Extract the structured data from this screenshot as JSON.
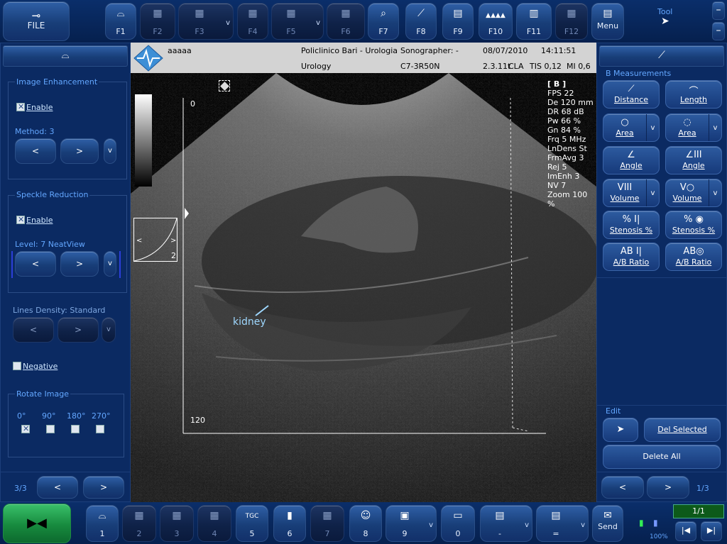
{
  "top_toolbar": {
    "file_label": "FILE",
    "f1_label": "F1",
    "f2_label": "F2",
    "f3_label": "F3",
    "f4_label": "F4",
    "f5_label": "F5",
    "f6_label": "F6",
    "f7_label": "F7",
    "f8_label": "F8",
    "f9_label": "F9",
    "f10_label": "F10",
    "f11_label": "F11",
    "f12_label": "F12",
    "menu_label": "Menu",
    "tool_label": "Tool",
    "dropdown_glyph": "v"
  },
  "info_bar": {
    "patient_name": "aaaaa",
    "hospital": "Policlinico Bari - Urologia",
    "department": "Urology",
    "sonographer": "Sonographer: -",
    "probe": "C7-3R50N",
    "date": "08/07/2010",
    "time": "14:11:51",
    "version": "2.3.11t",
    "preset": "CLA",
    "tis": "TIS 0,12",
    "mi": "MI 0,6"
  },
  "left_panel": {
    "image_enhancement": {
      "title": "Image Enhancement",
      "enable_label": "Enable",
      "method_label": "Method: 3"
    },
    "speckle_reduction": {
      "title": "Speckle Reduction",
      "enable_label": "Enable",
      "level_label": "Level: 7 NeatView"
    },
    "lines_density_label": "Lines Density: Standard",
    "negative_label": "Negative",
    "rotate_image": {
      "title": "Rotate Image",
      "options": [
        "0°",
        "90°",
        "180°",
        "270°"
      ]
    },
    "page": "3/3",
    "prev_glyph": "<",
    "next_glyph": ">",
    "dropdown_glyph": "v"
  },
  "image_overlay": {
    "depth_top": "0",
    "depth_bottom": "120",
    "gray_map_number": "2",
    "annotation": "kidney",
    "params": [
      "[ B ]",
      "FPS  22",
      "De  120 mm",
      "DR  68 dB",
      "Pw  66 %",
      "Gn  84 %",
      "Frq  5 MHz",
      "LnDens  St",
      "FrmAvg  3",
      "Rej  5",
      "ImEnh  3",
      "NV  7",
      "Zoom  100 %"
    ]
  },
  "right_panel": {
    "section_title": "B Measurements",
    "buttons": {
      "distance": "Distance",
      "length": "Length",
      "area1": "Area",
      "area2": "Area",
      "angle1": "Angle",
      "angle2": "Angle",
      "volume1": "Volume",
      "volume2": "Volume",
      "stenosis1": "Stenosis %",
      "stenosis2": "Stenosis %",
      "ab1": "A/B Ratio",
      "ab2": "A/B Ratio"
    },
    "edit_title": "Edit",
    "del_selected": "Del Selected",
    "delete_all": "Delete All",
    "page": "1/3",
    "prev_glyph": "<",
    "next_glyph": ">",
    "dropdown_glyph": "v"
  },
  "bottom_toolbar": {
    "b1": "1",
    "b2": "2",
    "b3": "3",
    "b4": "4",
    "b5": "5",
    "tgc": "TGC",
    "b6": "6",
    "b7": "7",
    "b8": "8",
    "b9": "9",
    "b0": "0",
    "minus": "-",
    "equals": "=",
    "send": "Send",
    "battery": "100%",
    "counter": "1/1",
    "dropdown_glyph": "v"
  }
}
